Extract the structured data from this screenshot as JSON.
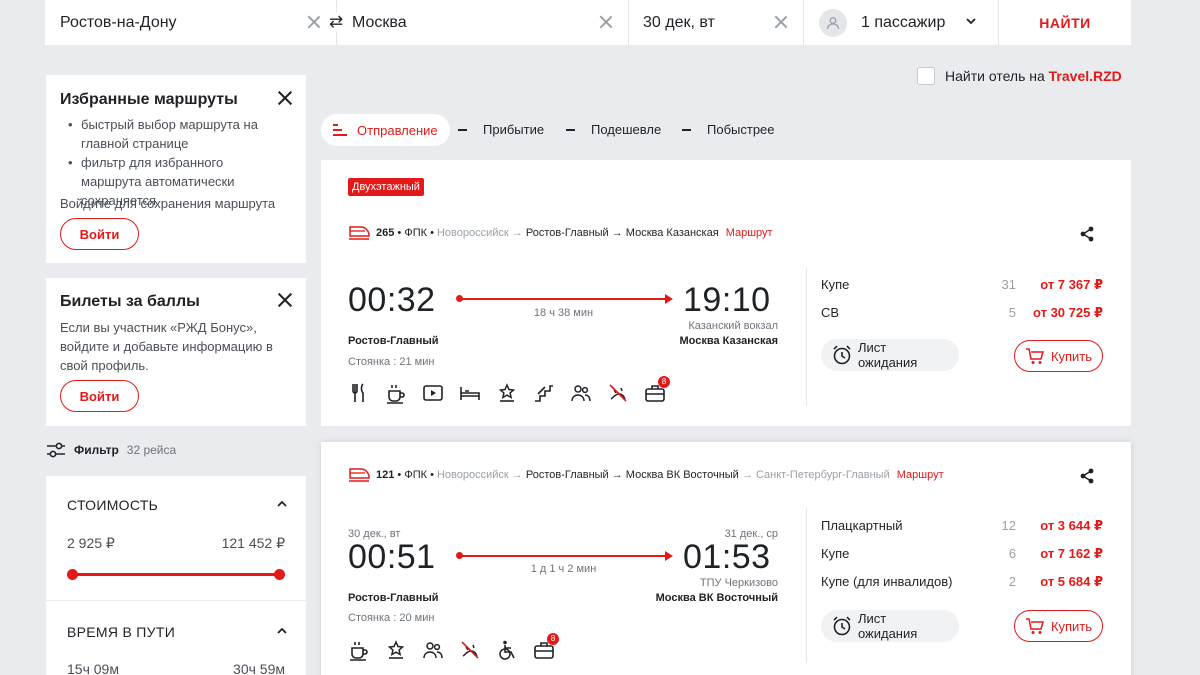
{
  "search": {
    "from": "Ростов-на-Дону",
    "to": "Москва",
    "date": "30 дек, вт",
    "passengers": "1 пассажир",
    "find_label": "НАЙТИ"
  },
  "hotel": {
    "label": "Найти отель на ",
    "brand": "Travel.RZD"
  },
  "favorites": {
    "title": "Избранные маршруты",
    "bullet1": "быстрый выбор маршрута на главной странице",
    "bullet2": "фильтр для избранного маршрута автоматически сохраняется",
    "note": "Войдите для сохранения маршрута",
    "login_label": "Войти"
  },
  "bonus": {
    "title": "Билеты за баллы",
    "text": "Если вы участник «РЖД Бонус», войдите и добавьте информацию в свой профиль.",
    "login_label": "Войти"
  },
  "filter": {
    "label": "Фильтр",
    "count": "32 рейса"
  },
  "cost_filter": {
    "title": "СТОИМОСТЬ",
    "min": "2 925 ₽",
    "max": "121 452 ₽",
    "range_low": 0,
    "range_high": 1
  },
  "time_filter": {
    "title": "ВРЕМЯ В ПУТИ",
    "min": "15ч 09м",
    "max": "30ч 59м"
  },
  "sort": {
    "departure": "Отправление",
    "arrival": "Прибытие",
    "cheaper": "Подешевле",
    "faster": "Побыстрее"
  },
  "train1": {
    "badge": "Двухэтажный",
    "number": "265",
    "carrier": "ФПК",
    "origin": "Новороссийск →",
    "route_text": "Ростов-Главный → Москва Казанская",
    "route_link": "Маршрут",
    "dep_time": "00:32",
    "arr_time": "19:10",
    "duration": "18 ч 38 мин",
    "dep_station": "Ростов-Главный",
    "arr_terminal": "Казанский вокзал",
    "arr_station": "Москва Казанская",
    "stop": "Стоянка : 21 мин",
    "amenity_badge": "8",
    "classes": [
      {
        "name": "Купе",
        "count": "31",
        "price": "от 7 367 ₽"
      },
      {
        "name": "СВ",
        "count": "5",
        "price": "от 30 725 ₽"
      }
    ],
    "wait_label": "Лист ожидания",
    "buy_label": "Купить"
  },
  "train2": {
    "number": "121",
    "carrier": "ФПК",
    "origin": "Новороссийск →",
    "route_text": "Ростов-Главный → Москва ВК Восточный",
    "dest_tail": "→ Санкт-Петербург-Главный",
    "route_link": "Маршрут",
    "dep_date": "30 дек., вт",
    "arr_date": "31 дек., ср",
    "dep_time": "00:51",
    "arr_time": "01:53",
    "duration": "1 д 1 ч 2 мин",
    "dep_station": "Ростов-Главный",
    "arr_terminal": "ТПУ Черкизово",
    "arr_station": "Москва ВК Восточный",
    "stop": "Стоянка : 20 мин",
    "amenity_badge": "8",
    "classes": [
      {
        "name": "Плацкартный",
        "count": "12",
        "price": "от 3 644 ₽"
      },
      {
        "name": "Купе",
        "count": "6",
        "price": "от 7 162 ₽"
      },
      {
        "name": "Купе (для инвалидов)",
        "count": "2",
        "price": "от 5 684 ₽"
      }
    ],
    "wait_label": "Лист ожидания",
    "buy_label": "Купить"
  }
}
